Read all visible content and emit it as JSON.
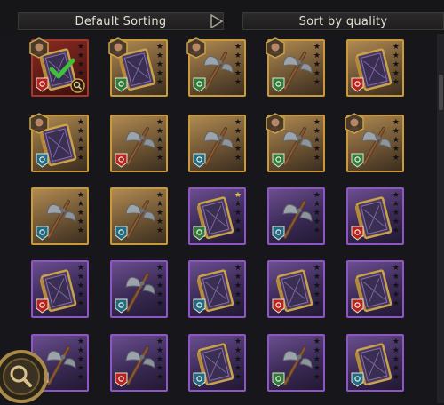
{
  "toolbar": {
    "default_sort_label": "Default Sorting",
    "quality_sort_label": "Sort by quality"
  },
  "colors": {
    "gold": "#c9993a",
    "purple": "#8e55c4",
    "red": "#a23a2c",
    "badge_red": "#b8231f",
    "badge_green": "#2f7d3a",
    "badge_teal": "#1f6c86"
  },
  "items": [
    {
      "rarity": "red",
      "type": "book",
      "badge": "red",
      "portrait": true,
      "stars": 0,
      "selected": true
    },
    {
      "rarity": "gold",
      "type": "book",
      "badge": "green",
      "portrait": true,
      "stars": 0
    },
    {
      "rarity": "gold",
      "type": "axe",
      "badge": "green",
      "portrait": true,
      "stars": 0
    },
    {
      "rarity": "gold",
      "type": "axe",
      "badge": "green",
      "portrait": true,
      "stars": 0
    },
    {
      "rarity": "gold",
      "type": "book",
      "badge": "red",
      "portrait": false,
      "stars": 0
    },
    {
      "rarity": "gold",
      "type": "book",
      "badge": "teal",
      "portrait": true,
      "stars": 0
    },
    {
      "rarity": "gold",
      "type": "axe",
      "badge": "red",
      "portrait": false,
      "stars": 0
    },
    {
      "rarity": "gold",
      "type": "axe",
      "badge": "teal",
      "portrait": false,
      "stars": 0
    },
    {
      "rarity": "gold",
      "type": "axe",
      "badge": "green",
      "portrait": true,
      "stars": 0
    },
    {
      "rarity": "gold",
      "type": "axe",
      "badge": "green",
      "portrait": true,
      "stars": 0
    },
    {
      "rarity": "gold",
      "type": "axe",
      "badge": "teal",
      "portrait": false,
      "stars": 0
    },
    {
      "rarity": "gold",
      "type": "axe",
      "badge": "teal",
      "portrait": false,
      "stars": 0
    },
    {
      "rarity": "purple",
      "type": "book",
      "badge": "green",
      "portrait": false,
      "stars": 1
    },
    {
      "rarity": "purple",
      "type": "axe",
      "badge": "teal",
      "portrait": false,
      "stars": 0
    },
    {
      "rarity": "purple",
      "type": "book",
      "badge": "red",
      "portrait": false,
      "stars": 0
    },
    {
      "rarity": "purple",
      "type": "book",
      "badge": "red",
      "portrait": false,
      "stars": 0
    },
    {
      "rarity": "purple",
      "type": "axe",
      "badge": "teal",
      "portrait": false,
      "stars": 0
    },
    {
      "rarity": "purple",
      "type": "book",
      "badge": "teal",
      "portrait": false,
      "stars": 0
    },
    {
      "rarity": "purple",
      "type": "book",
      "badge": "red",
      "portrait": false,
      "stars": 0
    },
    {
      "rarity": "purple",
      "type": "book",
      "badge": "red",
      "portrait": false,
      "stars": 0
    },
    {
      "rarity": "purple",
      "type": "axe",
      "badge": "teal",
      "portrait": false,
      "stars": 0
    },
    {
      "rarity": "purple",
      "type": "axe",
      "badge": "red",
      "portrait": false,
      "stars": 0
    },
    {
      "rarity": "purple",
      "type": "book",
      "badge": "teal",
      "portrait": false,
      "stars": 0
    },
    {
      "rarity": "purple",
      "type": "axe",
      "badge": "green",
      "portrait": false,
      "stars": 0
    },
    {
      "rarity": "purple",
      "type": "book",
      "badge": "teal",
      "portrait": false,
      "stars": 0
    }
  ]
}
